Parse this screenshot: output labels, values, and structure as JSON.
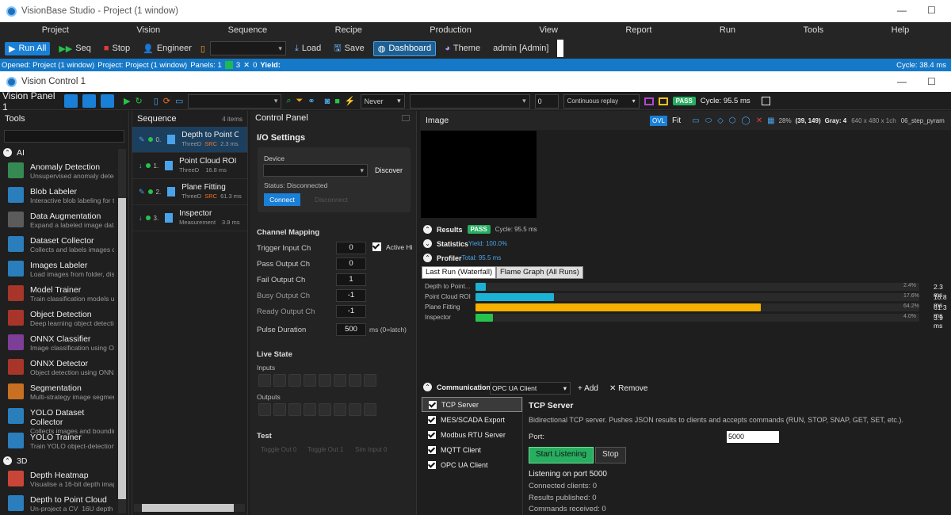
{
  "window": {
    "title": "VisionBase Studio - Project (1 window)"
  },
  "menu": [
    "Project",
    "Vision",
    "Sequence",
    "Recipe",
    "Production",
    "View",
    "Report",
    "Run",
    "Tools",
    "Help"
  ],
  "toolbar": {
    "run_all": "Run All",
    "seq": "Seq",
    "stop": "Stop",
    "engineer": "Engineer",
    "load": "Load",
    "save": "Save",
    "dashboard": "Dashboard",
    "theme": "Theme",
    "user": "admin  [Admin]"
  },
  "status": {
    "opened": "Opened: Project (1 window)",
    "project": "Project: Project (1 window)",
    "panels": "Panels: 1",
    "pass_count": "3",
    "fail_count": "0",
    "yield": "Yield:",
    "cycle": "Cycle: 38.4 ms"
  },
  "child_window": {
    "title": "Vision Control 1"
  },
  "vision_bar": {
    "panel_name": "Vision Panel 1",
    "trigger": "Never",
    "count": "0",
    "replay": "Continuous replay",
    "result": "PASS",
    "cycle": "Cycle: 95.5 ms"
  },
  "tools": {
    "header": "Tools",
    "groups": [
      {
        "name": "AI",
        "items": [
          {
            "title": "Anomaly Detection",
            "sub": "Unsupervised anomaly detec",
            "color": "#3a9d5d"
          },
          {
            "title": "Blob Labeler",
            "sub": "Interactive blob labeling for t",
            "color": "#2d8fd8"
          },
          {
            "title": "Data Augmentation",
            "sub": "Expand a labeled image data",
            "color": "#666"
          },
          {
            "title": "Dataset Collector",
            "sub": "Collects and labels images d",
            "color": "#2d8fd8"
          },
          {
            "title": "Images Labeler",
            "sub": "Load images from folder, disp",
            "color": "#2d8fd8"
          },
          {
            "title": "Model Trainer",
            "sub": "Train classification models us",
            "color": "#c0392b"
          },
          {
            "title": "Object Detection",
            "sub": "Deep learning object detectio",
            "color": "#c0392b"
          },
          {
            "title": "ONNX Classifier",
            "sub": "Image classification using ON",
            "color": "#8e44ad"
          },
          {
            "title": "ONNX Detector",
            "sub": "Object detection using ONNX",
            "color": "#c0392b"
          },
          {
            "title": "Segmentation",
            "sub": "Multi-strategy image segmer",
            "color": "#e67e22"
          },
          {
            "title": "YOLO Dataset Collector",
            "sub": "Collects images and boundin",
            "color": "#2d8fd8"
          },
          {
            "title": "YOLO Trainer",
            "sub": "Train YOLO object-detection",
            "color": "#2d8fd8"
          }
        ]
      },
      {
        "name": "3D",
        "items": [
          {
            "title": "Depth Heatmap",
            "sub": "Visualise a 16-bit depth imag",
            "color": "#e74c3c"
          },
          {
            "title": "Depth to Point Cloud",
            "sub": "Un-project a CV_16U depth",
            "color": "#2d8fd8"
          }
        ]
      }
    ]
  },
  "sequence": {
    "header": "Sequence",
    "count": "4 items",
    "items": [
      {
        "num": "0.",
        "name": "Depth to Point Cl",
        "cat": "ThreeD",
        "src": "SRC",
        "time": "2.3 ms"
      },
      {
        "num": "1.",
        "name": "Point Cloud ROI",
        "cat": "ThreeD",
        "src": "",
        "time": "16.8 ms"
      },
      {
        "num": "2.",
        "name": "Plane Fitting",
        "cat": "ThreeD",
        "src": "SRC",
        "time": "61.3 ms"
      },
      {
        "num": "3.",
        "name": "Inspector",
        "cat": "Measurement",
        "src": "",
        "time": "3.9 ms"
      }
    ]
  },
  "control": {
    "header": "Control Panel",
    "io_title": "I/O Settings",
    "device_label": "Device",
    "discover": "Discover",
    "status": "Status: Disconnected",
    "connect": "Connect",
    "disconnect": "Disconnect",
    "channel_title": "Channel Mapping",
    "channels": [
      {
        "label": "Trigger Input Ch",
        "value": "0"
      },
      {
        "label": "Pass Output Ch",
        "value": "0"
      },
      {
        "label": "Fail Output Ch",
        "value": "1"
      },
      {
        "label": "Busy Output Ch",
        "value": "-1"
      },
      {
        "label": "Ready Output Ch",
        "value": "-1"
      }
    ],
    "active_hi": "Active Hi",
    "pulse_label": "Pulse Duration",
    "pulse_value": "500",
    "pulse_unit": "ms (0=latch)",
    "live_title": "Live State",
    "inputs": "Inputs",
    "outputs": "Outputs",
    "test_title": "Test",
    "toggle0": "Toggle Out 0",
    "toggle1": "Toggle Out 1",
    "sim_input": "Sim Input 0"
  },
  "image": {
    "header": "Image",
    "ovl": "OVL",
    "fit": "Fit",
    "zoom": "28%",
    "coords": "(39, 149)",
    "gray": "Gray: 4",
    "dims": "640 x 480 x 1ch",
    "file": "06_step_pyram"
  },
  "results": {
    "label": "Results",
    "status": "PASS",
    "cycle": "Cycle: 95.5 ms",
    "stats_label": "Statistics",
    "yield": "Yield: 100.0%",
    "profiler_label": "Profiler",
    "total": "Total: 95.5 ms",
    "tab_last": "Last Run (Waterfall)",
    "tab_flame": "Flame Graph (All Runs)"
  },
  "profiler_rows": [
    {
      "name": "Depth to Point...",
      "pct": "2.4%",
      "ms": "2.3 ms",
      "value": 2.4,
      "color": "#1ab3d6"
    },
    {
      "name": "Point Cloud ROI",
      "pct": "17.6%",
      "ms": "16.8 ms",
      "value": 17.6,
      "color": "#1ab3d6"
    },
    {
      "name": "Plane Fitting",
      "pct": "64.2%",
      "ms": "61.3 ms",
      "value": 64.2,
      "color": "#f5b000"
    },
    {
      "name": "Inspector",
      "pct": "4.0%",
      "ms": "3.9 ms",
      "value": 4.0,
      "color": "#27c24c"
    }
  ],
  "comm": {
    "label": "Communication",
    "protocol": "OPC UA Client",
    "add": "+ Add",
    "remove": "✕ Remove",
    "channels": [
      "TCP Server",
      "MES/SCADA Export",
      "Modbus RTU Server",
      "MQTT Client",
      "OPC UA Client"
    ],
    "title": "TCP Server",
    "desc": "Bidirectional TCP server. Pushes JSON results to clients and accepts commands (RUN, STOP, SNAP, GET, SET, etc.).",
    "port_label": "Port:",
    "port": "5000",
    "start": "Start Listening",
    "stop": "Stop",
    "listening": "Listening on port 5000",
    "clients": "Connected clients: 0",
    "published": "Results published: 0",
    "commands": "Commands received: 0"
  }
}
